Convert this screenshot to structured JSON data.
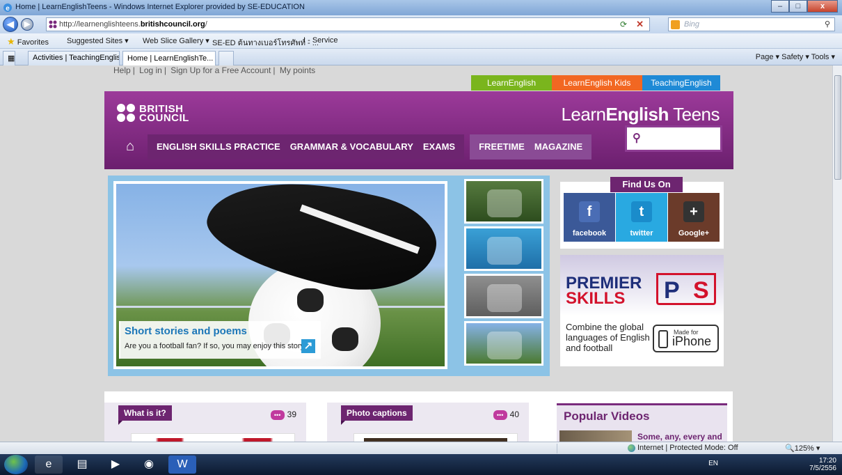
{
  "window": {
    "title": "Home | LearnEnglishTeens - Windows Internet Explorer provided by SE-EDUCATION",
    "buttons": {
      "minimize": "–",
      "maximize": "□",
      "close": "x"
    }
  },
  "address_bar": {
    "url_prefix": "http://learnenglishteens.",
    "url_domain": "britishcouncil.org",
    "url_suffix": "/",
    "search_placeholder": "Bing"
  },
  "favorites_bar": {
    "favorites_label": "Favorites",
    "items": [
      "Suggested Sites ▾",
      "Web Slice Gallery ▾",
      "SE-ED ต้นทางเบอร์โทรศัพท์ - ...",
      "I - Service"
    ]
  },
  "tabs": {
    "items": [
      {
        "label": "Activities | TeachingEnglis..."
      },
      {
        "label": "Home | LearnEnglishTe...  ✕"
      }
    ],
    "tools": "Page ▾   Safety ▾   Tools ▾"
  },
  "page": {
    "top_links": [
      "Help",
      "Log in",
      "Sign Up for a Free Account",
      "My points"
    ],
    "site_tabs": [
      {
        "label": "LearnEnglish",
        "color": "#7ab51d"
      },
      {
        "label": "LearnEnglish Kids",
        "color": "#f26722"
      },
      {
        "label": "TeachingEnglish",
        "color": "#1f8ad6"
      }
    ],
    "brand": {
      "bc_line1": "BRITISH",
      "bc_line2": "COUNCIL",
      "site_name_prefix": "Learn",
      "site_name_bold": "English",
      "site_name_suffix": " Teens"
    },
    "nav": {
      "group1": [
        "ENGLISH SKILLS PRACTICE",
        "GRAMMAR & VOCABULARY",
        "EXAMS"
      ],
      "group2": [
        "FREETIME",
        "MAGAZINE"
      ]
    },
    "carousel": {
      "caption_title": "Short stories and poems",
      "caption_text": "Are you a football fan? If so, you may enjoy this story."
    },
    "find_us": {
      "label": "Find Us On",
      "items": [
        {
          "label": "facebook",
          "icon": "f",
          "color": "#3b5998"
        },
        {
          "label": "twitter",
          "icon": "t",
          "color": "#29a9e1"
        },
        {
          "label": "Google+",
          "icon": "+",
          "color": "#6b3b2a"
        }
      ]
    },
    "premier": {
      "title1": "PREMIER",
      "title2": "SKILLS",
      "logo_p": "P",
      "logo_s": "S",
      "text": "Combine the global languages of English and football",
      "badge_small": "Made for",
      "badge_big": "iPhone"
    },
    "cards": [
      {
        "label": "What is it?",
        "count": "39"
      },
      {
        "label": "Photo captions",
        "count": "40"
      }
    ],
    "popular": {
      "title": "Popular Videos",
      "item": "Some, any, every and"
    }
  },
  "status_bar": {
    "zone": "Internet | Protected Mode: Off",
    "zoom": "125%"
  },
  "taskbar": {
    "lang": "EN",
    "time": "17:20",
    "date": "7/5/2556"
  }
}
